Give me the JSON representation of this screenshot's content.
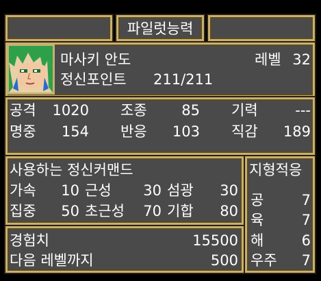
{
  "header": {
    "title": "파일럿능력"
  },
  "pilot": {
    "name": "마사키 안도",
    "level_label": "레벨",
    "level": "32",
    "sp_label": "정신포인트",
    "sp_value": "211/211"
  },
  "stats": {
    "row1": [
      {
        "label": "공격",
        "value": "1020"
      },
      {
        "label": "조종",
        "value": "85"
      },
      {
        "label": "기력",
        "value": "---"
      }
    ],
    "row2": [
      {
        "label": "명중",
        "value": "154"
      },
      {
        "label": "반응",
        "value": "103"
      },
      {
        "label": "직감",
        "value": "189"
      }
    ]
  },
  "spirit": {
    "header": "사용하는 정신커맨드",
    "row1": [
      {
        "name": "가속",
        "cost": "10"
      },
      {
        "name": "근성",
        "cost": "30"
      },
      {
        "name": "섬광",
        "cost": "30"
      }
    ],
    "row2": [
      {
        "name": "집중",
        "cost": "50"
      },
      {
        "name": "초근성",
        "cost": "70"
      },
      {
        "name": "기합",
        "cost": "80"
      }
    ]
  },
  "terrain": {
    "header": "지형적응",
    "items": [
      {
        "label": "공",
        "value": "7"
      },
      {
        "label": "육",
        "value": "7"
      },
      {
        "label": "해",
        "value": "6"
      },
      {
        "label": "우주",
        "value": "7"
      }
    ]
  },
  "experience": {
    "exp_label": "경험치",
    "exp_value": "15500",
    "next_label": "다음 레벨까지",
    "next_value": "500"
  },
  "colors": {
    "frame": "#c8b070",
    "panel": "#4a4a4a",
    "text": "#ffffff"
  }
}
